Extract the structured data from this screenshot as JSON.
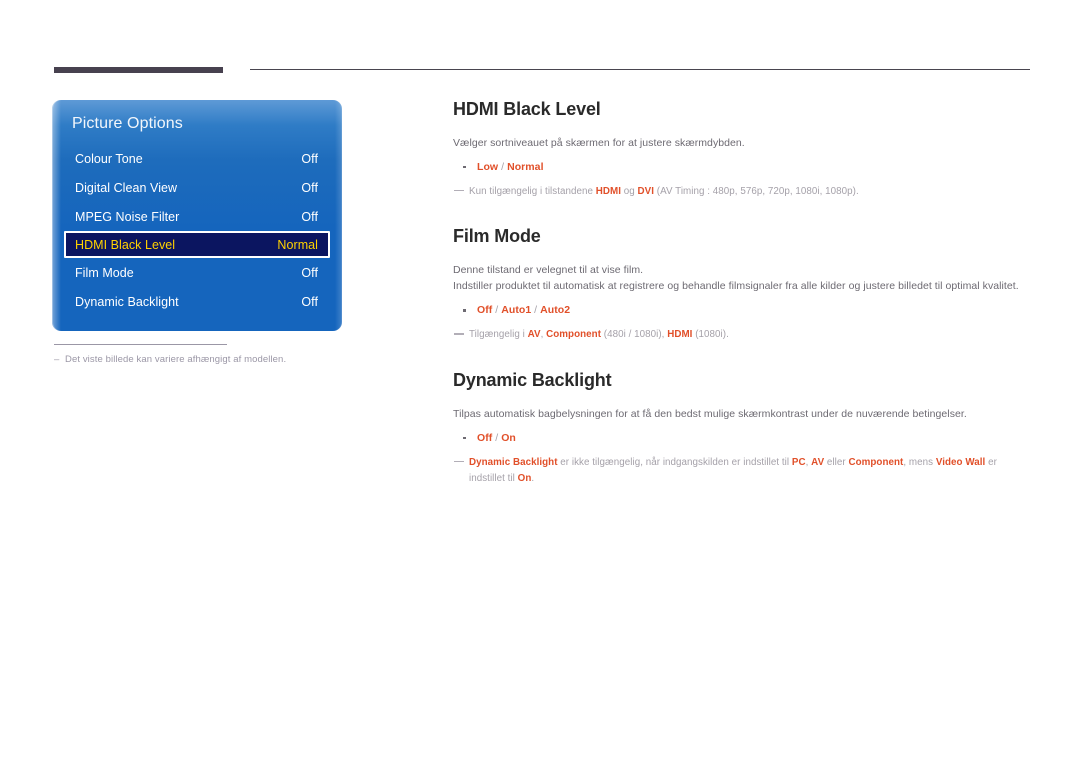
{
  "page": {
    "language": "da",
    "accent_color": "#e1502a",
    "heading_color": "#2a2a2a",
    "body_color": "#6d6a72",
    "note_color": "#a5a1a9",
    "osd_highlight_bg": "#0b1560",
    "osd_highlight_text": "#ffd200",
    "osd_blue": "#1565bd"
  },
  "osd": {
    "title": "Picture Options",
    "rows": [
      {
        "label": "Colour Tone",
        "value": "Off",
        "selected": false
      },
      {
        "label": "Digital Clean View",
        "value": "Off",
        "selected": false
      },
      {
        "label": "MPEG Noise Filter",
        "value": "Off",
        "selected": false
      },
      {
        "label": "HDMI Black Level",
        "value": "Normal",
        "selected": true
      },
      {
        "label": "Film Mode",
        "value": "Off",
        "selected": false
      },
      {
        "label": "Dynamic Backlight",
        "value": "Off",
        "selected": false
      }
    ]
  },
  "figure_note": {
    "dash": "–",
    "text": "Det viste billede kan variere afhængigt af modellen."
  },
  "sections": [
    {
      "id": "hdmi-black-level",
      "title": "HDMI Black Level",
      "body": [
        "Vælger sortniveauet på skærmen for at justere skærmdybden."
      ],
      "option": {
        "parts": [
          {
            "t": "Low",
            "style": "bold"
          },
          {
            "t": " / ",
            "style": "sep"
          },
          {
            "t": "Normal",
            "style": "bold"
          }
        ]
      },
      "notes": [
        {
          "parts": [
            {
              "t": "Kun tilgængelig i tilstandene ",
              "style": "plain"
            },
            {
              "t": "HDMI",
              "style": "accent"
            },
            {
              "t": " og ",
              "style": "plain"
            },
            {
              "t": "DVI",
              "style": "accent"
            },
            {
              "t": " (AV Timing : 480p, 576p, 720p, 1080i, 1080p).",
              "style": "plain"
            }
          ]
        }
      ]
    },
    {
      "id": "film-mode",
      "title": "Film Mode",
      "body": [
        "Denne tilstand er velegnet til at vise film.",
        "Indstiller produktet til automatisk at registrere og behandle filmsignaler fra alle kilder og justere billedet til optimal kvalitet."
      ],
      "option": {
        "parts": [
          {
            "t": "Off",
            "style": "bold"
          },
          {
            "t": " / ",
            "style": "sep"
          },
          {
            "t": "Auto1",
            "style": "bold"
          },
          {
            "t": " / ",
            "style": "sep"
          },
          {
            "t": "Auto2",
            "style": "bold"
          }
        ]
      },
      "notes": [
        {
          "parts": [
            {
              "t": "Tilgængelig i ",
              "style": "plain"
            },
            {
              "t": "AV",
              "style": "accent"
            },
            {
              "t": ", ",
              "style": "plain"
            },
            {
              "t": "Component",
              "style": "accent"
            },
            {
              "t": " (480i / 1080i), ",
              "style": "plain"
            },
            {
              "t": "HDMI",
              "style": "accent"
            },
            {
              "t": " (1080i).",
              "style": "plain"
            }
          ]
        }
      ]
    },
    {
      "id": "dynamic-backlight",
      "title": "Dynamic Backlight",
      "body": [
        "Tilpas automatisk bagbelysningen for at få den bedst mulige skærmkontrast under de nuværende betingelser."
      ],
      "option": {
        "parts": [
          {
            "t": "Off",
            "style": "bold"
          },
          {
            "t": " / ",
            "style": "sep"
          },
          {
            "t": "On",
            "style": "bold"
          }
        ]
      },
      "notes": [
        {
          "parts": [
            {
              "t": "Dynamic Backlight",
              "style": "accent"
            },
            {
              "t": " er ikke tilgængelig, når indgangskilden er indstillet til ",
              "style": "plain"
            },
            {
              "t": "PC",
              "style": "accent"
            },
            {
              "t": ", ",
              "style": "plain"
            },
            {
              "t": "AV",
              "style": "accent"
            },
            {
              "t": " eller ",
              "style": "plain"
            },
            {
              "t": "Component",
              "style": "accent"
            },
            {
              "t": ", mens ",
              "style": "plain"
            },
            {
              "t": "Video Wall",
              "style": "accent"
            },
            {
              "t": " er indstillet til ",
              "style": "plain"
            },
            {
              "t": "On",
              "style": "accent"
            },
            {
              "t": ".",
              "style": "plain"
            }
          ]
        }
      ]
    }
  ]
}
